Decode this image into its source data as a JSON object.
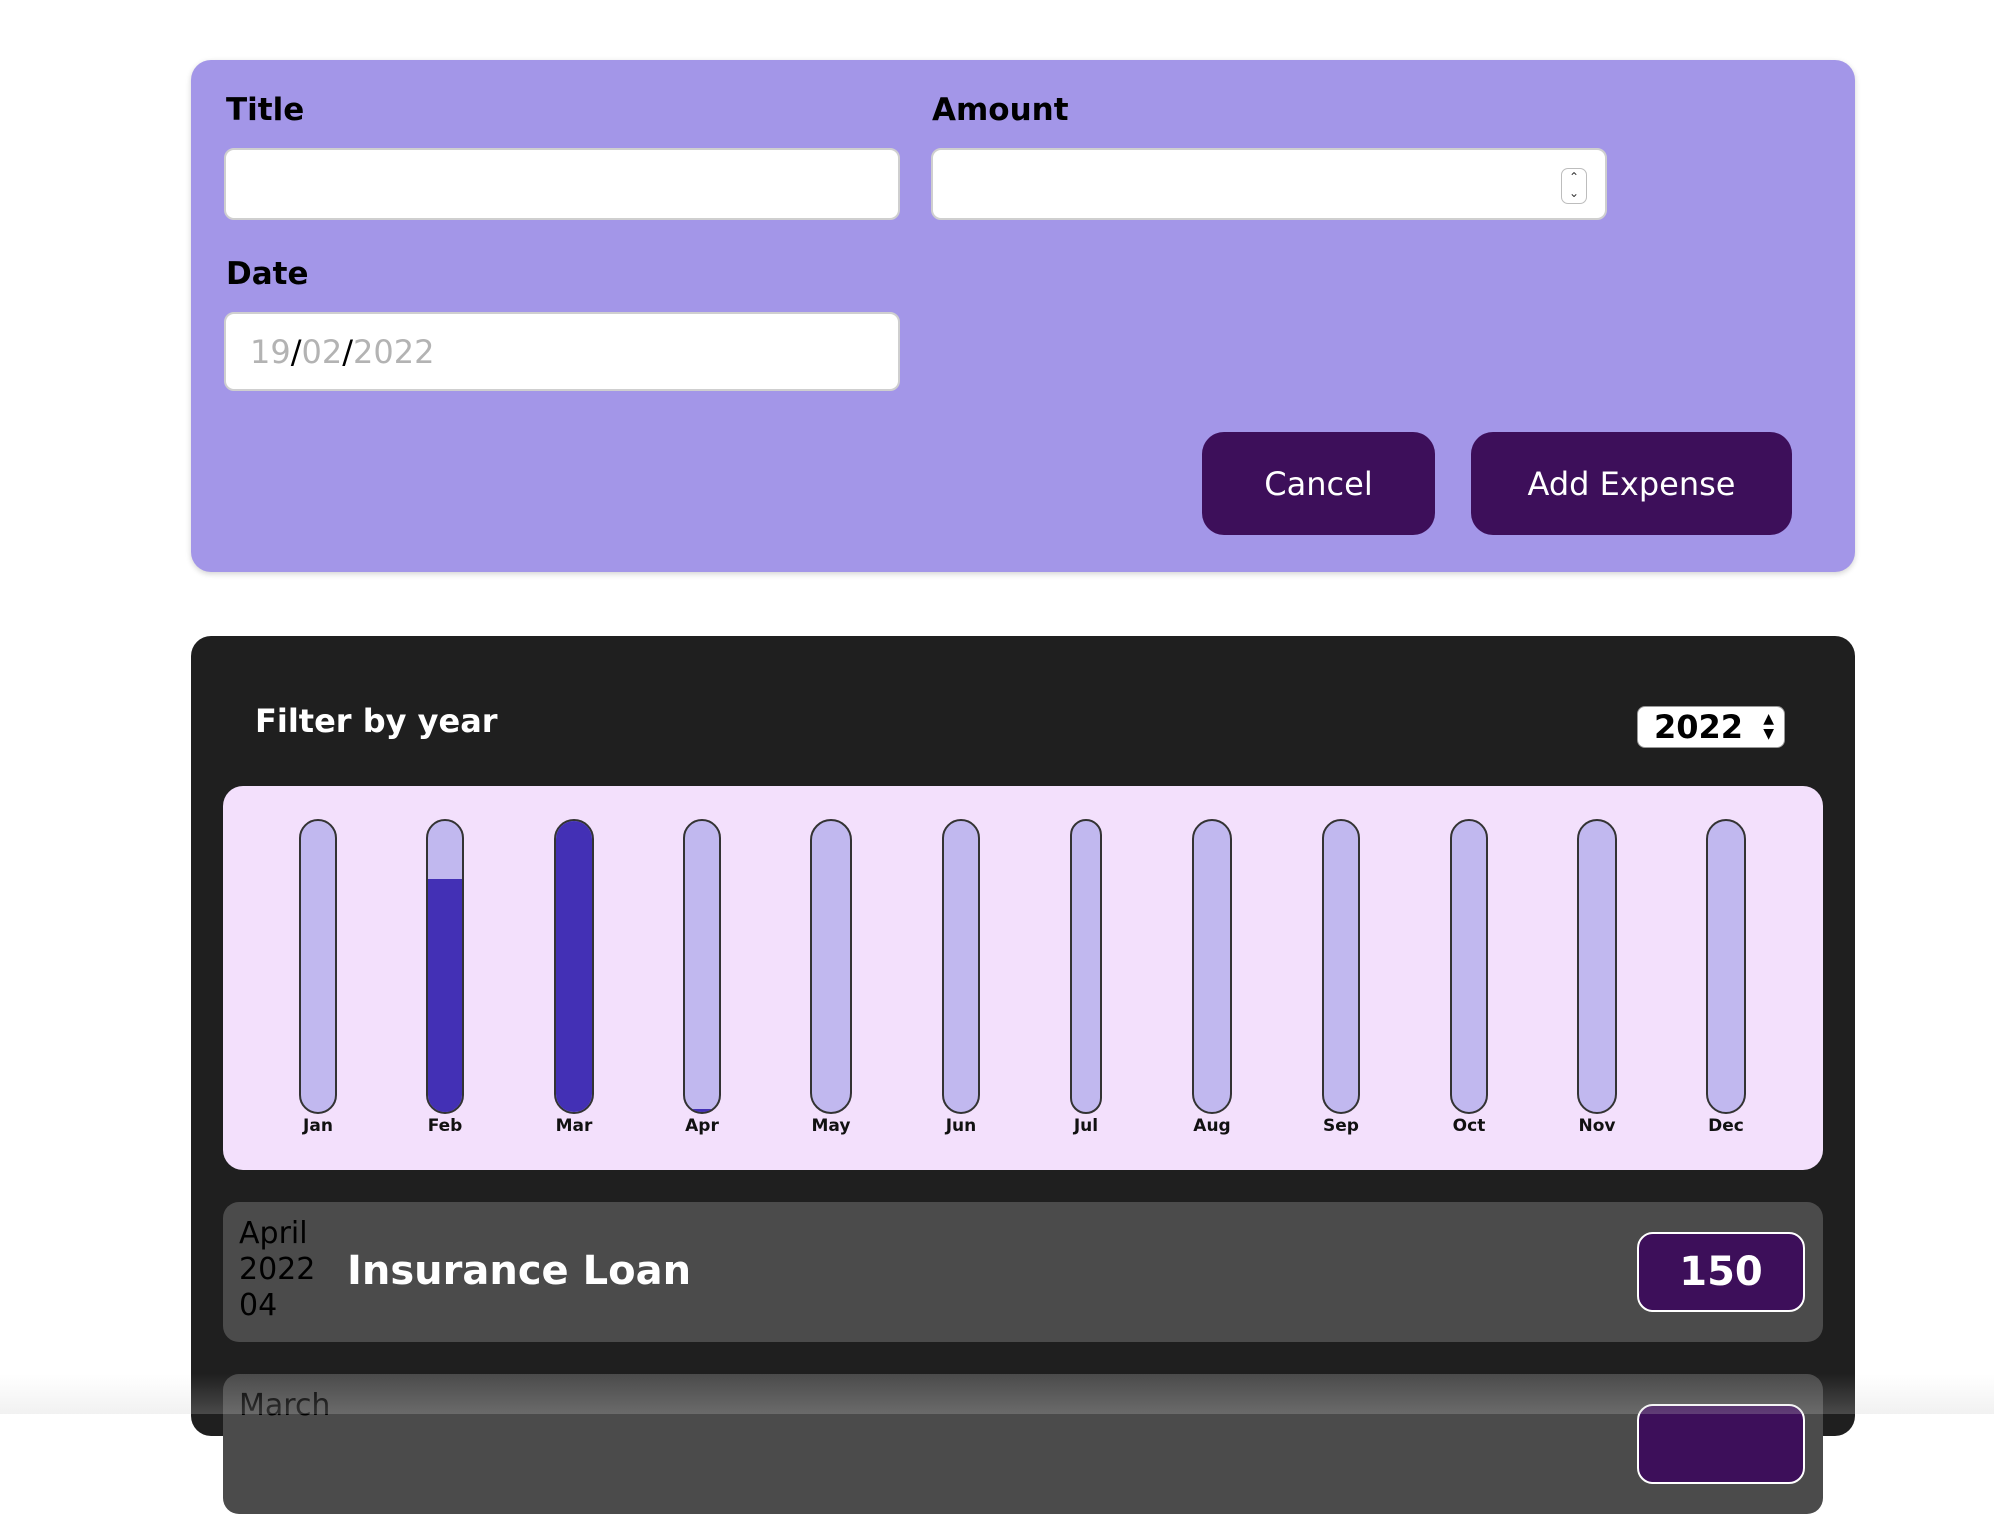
{
  "form": {
    "title_label": "Title",
    "title_value": "",
    "amount_label": "Amount",
    "amount_value": "",
    "date_label": "Date",
    "date_day": "19",
    "date_month": "02",
    "date_year": "2022",
    "date_separator": "/",
    "cancel_label": "Cancel",
    "submit_label": "Add Expense"
  },
  "filter": {
    "label": "Filter by year",
    "selected_year": "2022"
  },
  "chart_data": {
    "type": "bar",
    "categories": [
      "Jan",
      "Feb",
      "Mar",
      "Apr",
      "May",
      "Jun",
      "Jul",
      "Aug",
      "Sep",
      "Oct",
      "Nov",
      "Dec"
    ],
    "values": [
      0,
      0.8,
      1.0,
      0.01,
      0,
      0,
      0,
      0,
      0,
      0,
      0,
      0
    ],
    "colors": {
      "fill": "#4330b5",
      "track": "#c1b8ef",
      "background": "#f3e0fc"
    }
  },
  "expenses": [
    {
      "month": "April",
      "year": "2022",
      "day": "04",
      "title": "Insurance Loan",
      "amount": "150"
    },
    {
      "month": "March",
      "year": "",
      "day": "",
      "title": "",
      "amount": ""
    }
  ],
  "colors": {
    "form_bg": "#a396e8",
    "button_bg": "#3d0f5a",
    "panel_bg": "#1f1f1f",
    "item_bg": "#4b4b4b"
  }
}
